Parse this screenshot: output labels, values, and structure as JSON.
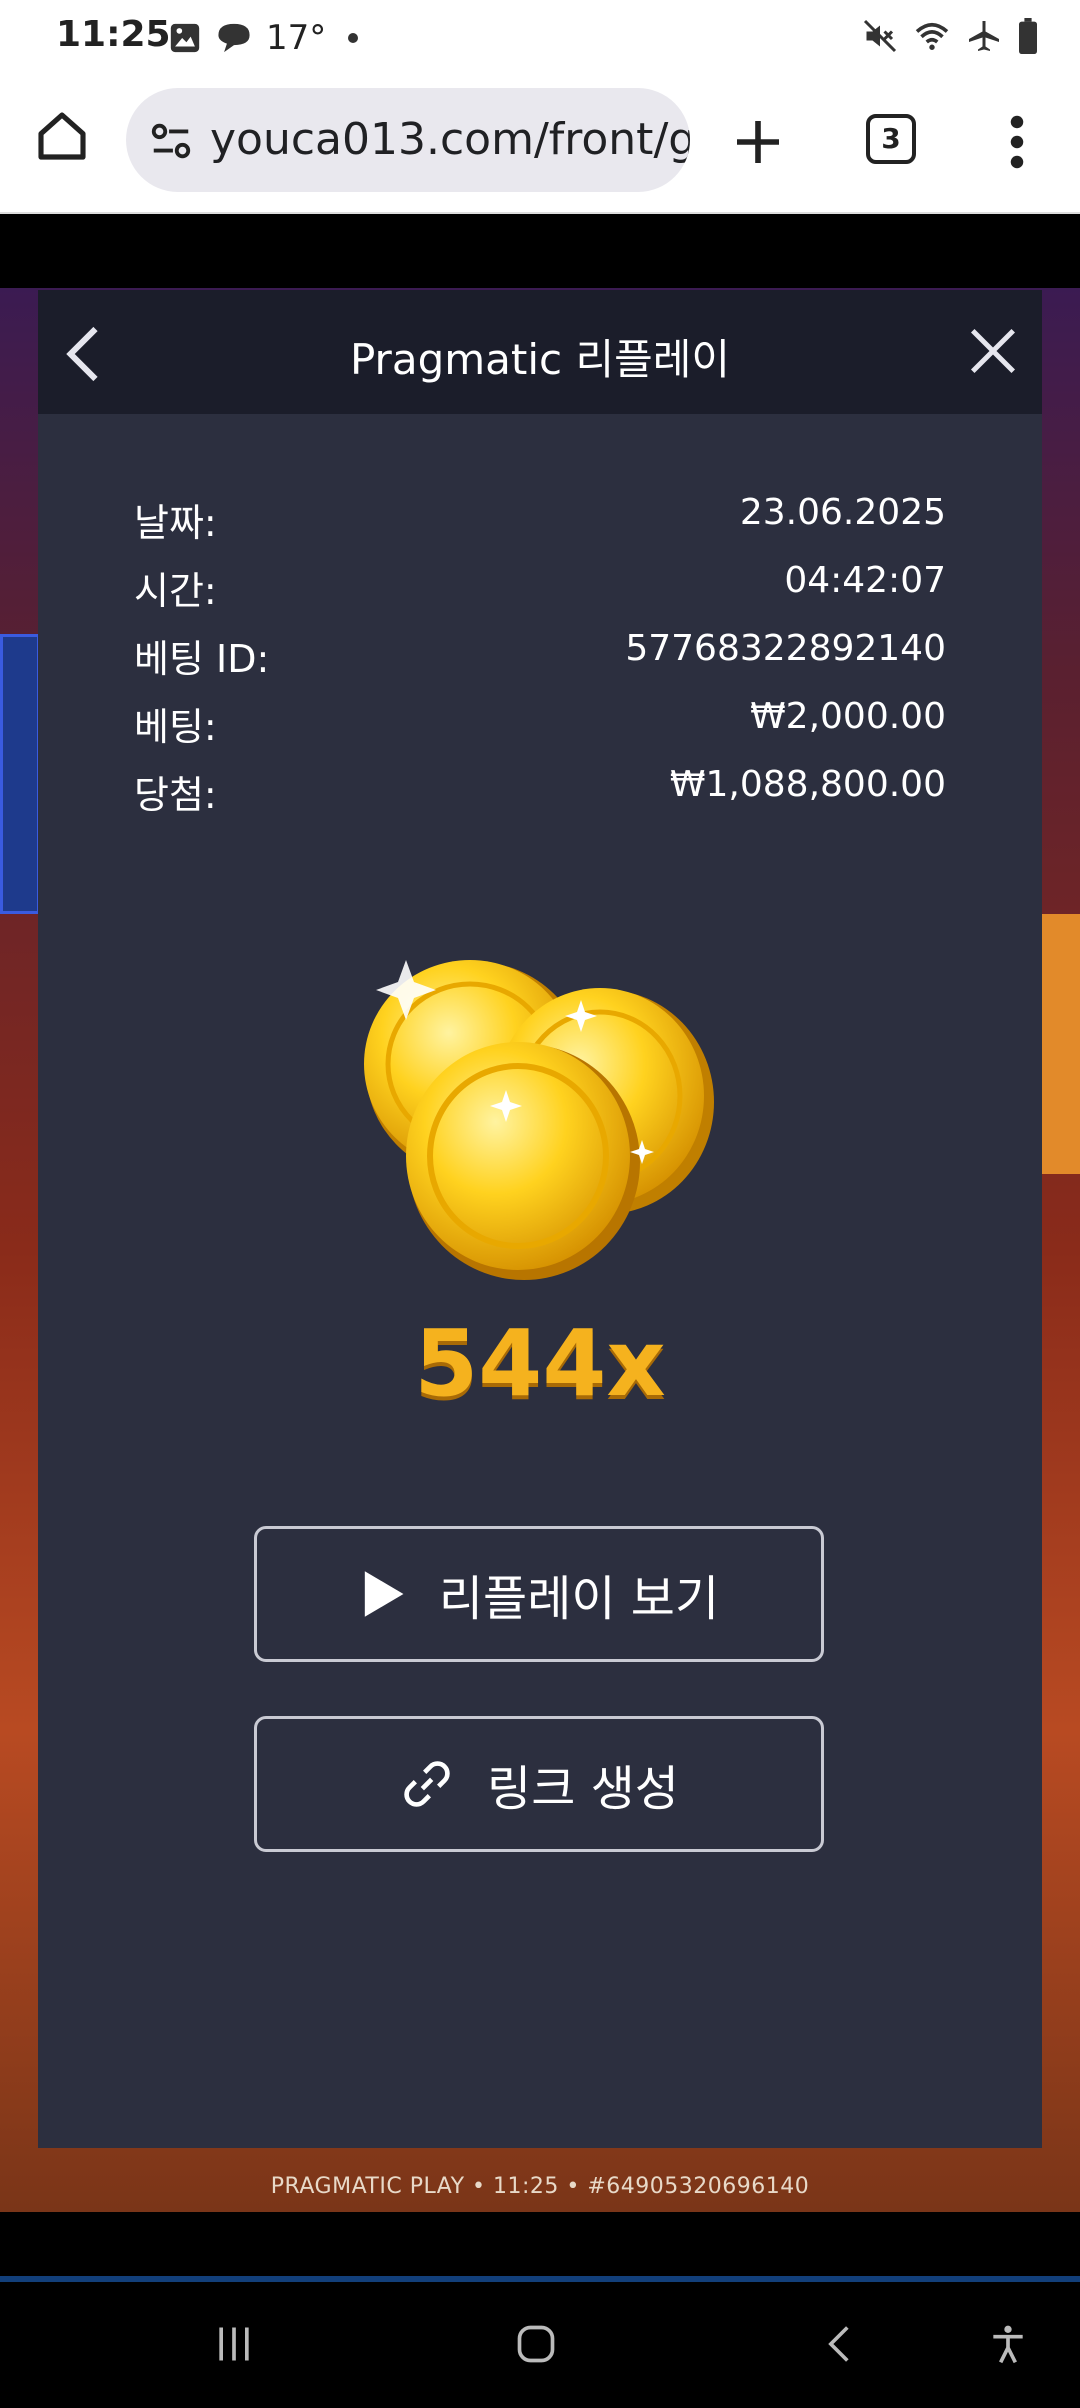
{
  "status_bar": {
    "time": "11:25",
    "temperature": "17°"
  },
  "browser": {
    "url": "youca013.com/front/ga",
    "tab_count": "3"
  },
  "modal": {
    "title": "Pragmatic 리플레이",
    "rows": [
      {
        "label": "날짜:",
        "value": "23.06.2025"
      },
      {
        "label": "시간:",
        "value": "04:42:07"
      },
      {
        "label": "베팅 ID:",
        "value": "57768322892140"
      },
      {
        "label": "베팅:",
        "value": "₩2,000.00"
      },
      {
        "label": "당첨:",
        "value": "₩1,088,800.00"
      }
    ],
    "multiplier": "544x",
    "replay_button": "리플레이 보기",
    "link_button": "링크 생성"
  },
  "game": {
    "footer_caption": "PRAGMATIC PLAY • 11:25 • #64905320696140"
  },
  "colors": {
    "modal_bg": "#2c2f3f",
    "modal_header_bg": "#1b1d2a",
    "multiplier": "#f5b21e"
  }
}
